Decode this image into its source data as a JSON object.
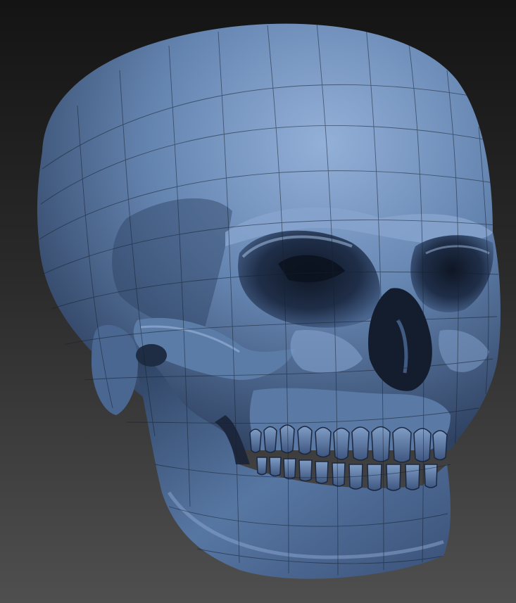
{
  "scene": {
    "subject": "skull-sculpt",
    "render": {
      "material_color": "#5a7aa6",
      "highlight_color": "#8ba8d0",
      "shadow_color": "#1c2a42",
      "wireframe_color": "#15202f",
      "background_top": "#141414",
      "background_bottom": "#4f4f4f"
    }
  }
}
